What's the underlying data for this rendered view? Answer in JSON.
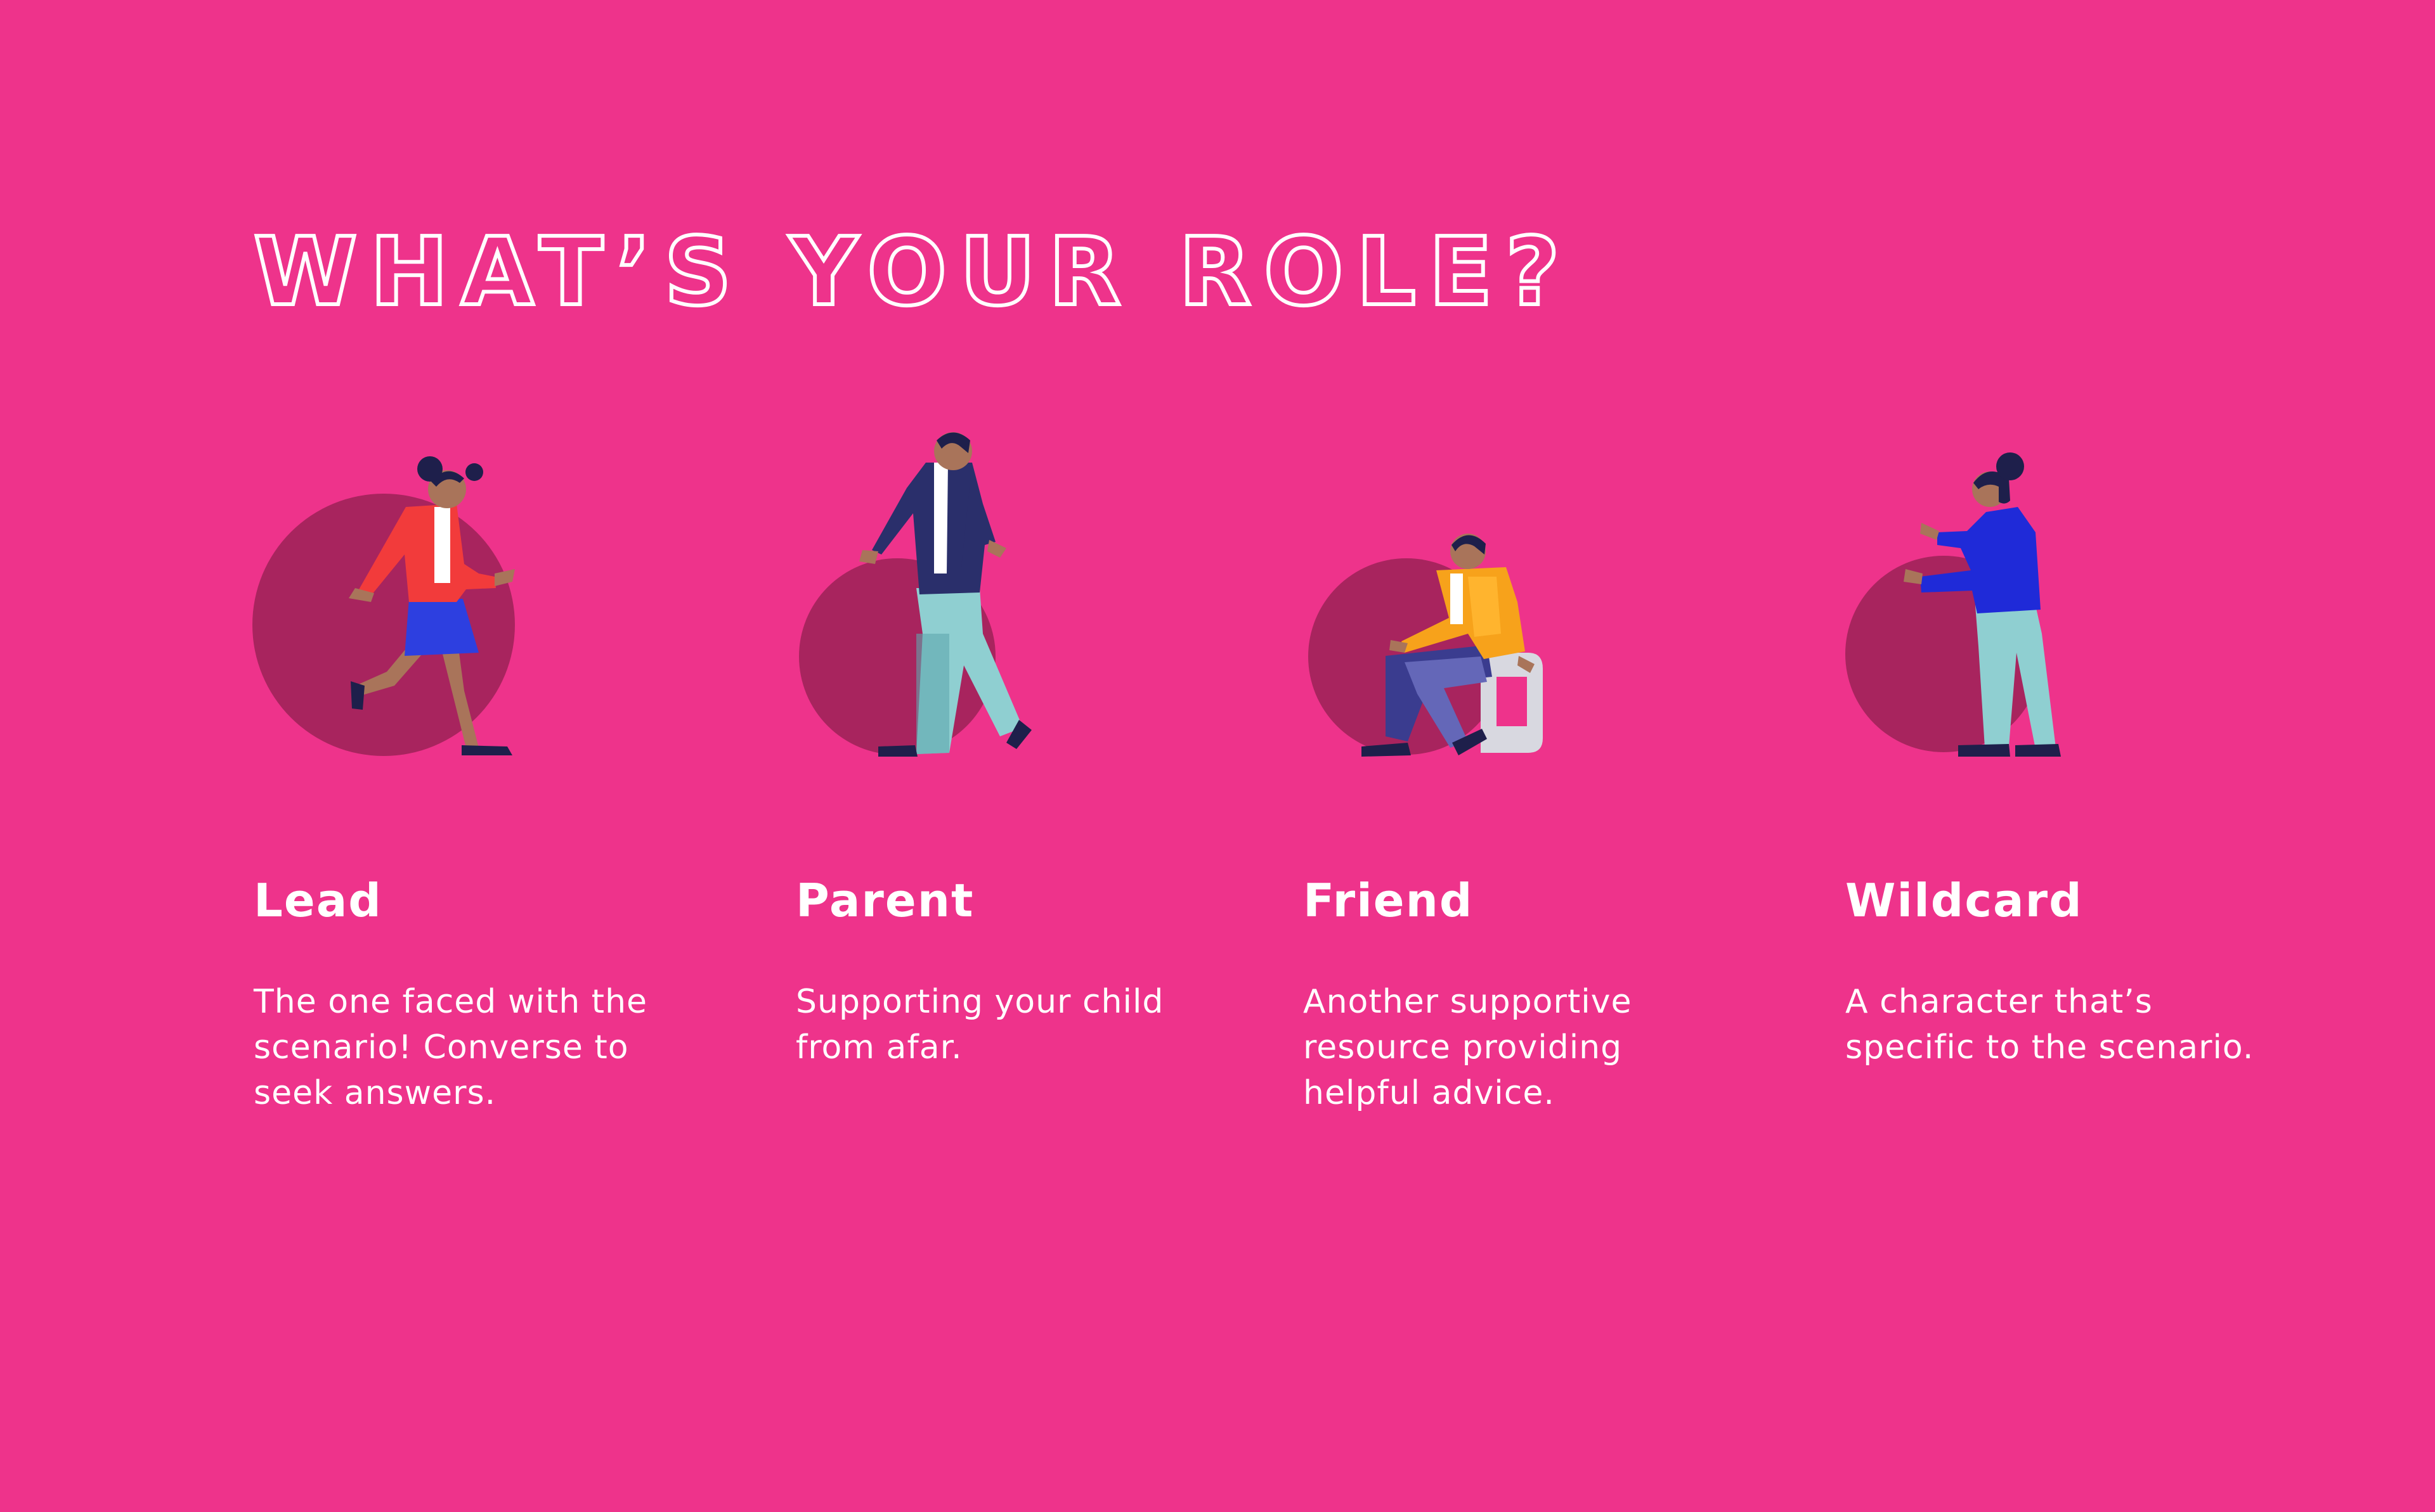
{
  "page": {
    "title": "WHAT’S YOUR ROLE?",
    "background": "#EE338B"
  },
  "roles": [
    {
      "name": "Lead",
      "description": "The one faced with the scenario! Converse to seek answers.",
      "illustration": "running-woman-illustration"
    },
    {
      "name": "Parent",
      "description": "Supporting your child from afar.",
      "illustration": "walking-man-illustration"
    },
    {
      "name": "Friend",
      "description": "Another supportive resource providing helpful advice.",
      "illustration": "seated-man-illustration"
    },
    {
      "name": "Wildcard",
      "description": "A character that’s specific to the scenario.",
      "illustration": "standing-woman-illustration"
    }
  ],
  "colors": {
    "circle": "#A8245E",
    "text": "#FFFFFF",
    "navy": "#1E1F4B",
    "skin": "#A9745A"
  }
}
